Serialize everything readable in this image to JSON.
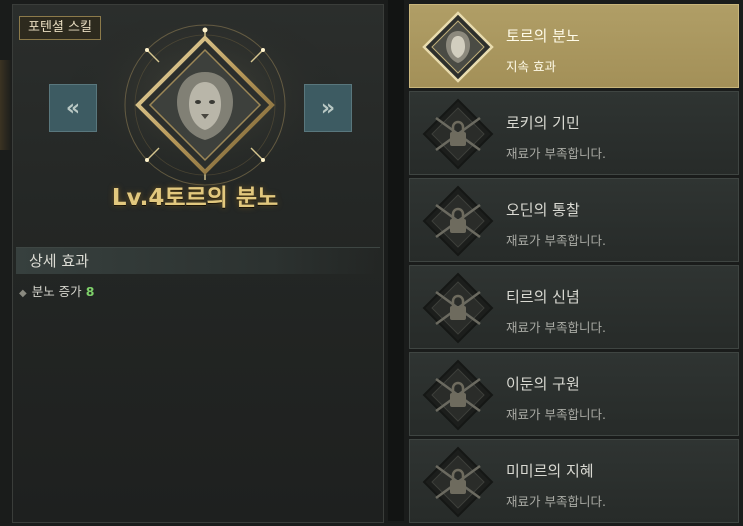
{
  "left_panel": {
    "tag_label": "포텐셜 스킬",
    "nav_prev": "«",
    "nav_next": "»",
    "skill_title": "Lv.4토르의 분노",
    "detail_header": "상세 효과",
    "stats": [
      {
        "label": "분노 증가",
        "value": "8"
      }
    ]
  },
  "skill_list": [
    {
      "name": "토르의 분노",
      "status": "지속 효과",
      "active": true,
      "locked": false
    },
    {
      "name": "로키의 기민",
      "status": "재료가 부족합니다.",
      "active": false,
      "locked": true
    },
    {
      "name": "오딘의 통찰",
      "status": "재료가 부족합니다.",
      "active": false,
      "locked": true
    },
    {
      "name": "티르의 신념",
      "status": "재료가 부족합니다.",
      "active": false,
      "locked": true
    },
    {
      "name": "이둔의 구원",
      "status": "재료가 부족합니다.",
      "active": false,
      "locked": true
    },
    {
      "name": "미미르의 지혜",
      "status": "재료가 부족합니다.",
      "active": false,
      "locked": true
    }
  ],
  "colors": {
    "title_gold": "#e2c87e",
    "active_item": "#b09e66",
    "stat_value_green": "#7ed06a",
    "arrow_teal": "#3d5b62"
  },
  "icons": {
    "hero": "lion-portrait-diamond-icon",
    "locked": "chain-lock-diamond-icon"
  }
}
